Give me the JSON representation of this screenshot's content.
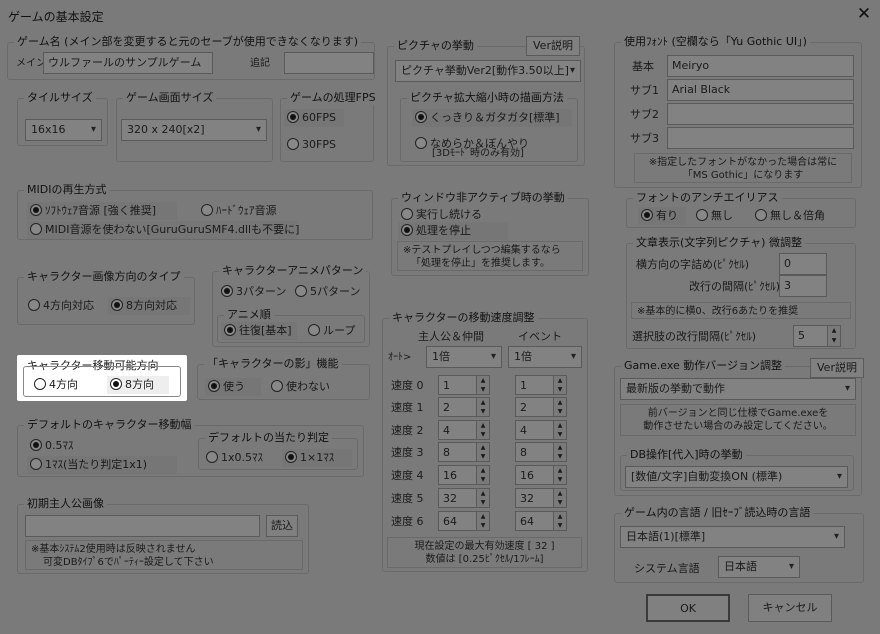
{
  "window": {
    "title": "ゲームの基本設定",
    "close": "✕"
  },
  "game_name": {
    "caption": "ゲーム名 (メイン部を変更すると元のセーブが使用できなくなります)",
    "main_label": "メイン",
    "main_value": "ウルファールのサンプルゲーム",
    "extra_label": "追記",
    "extra_value": ""
  },
  "tile_size": {
    "caption": "タイルサイズ",
    "value": "16x16"
  },
  "screen_size": {
    "caption": "ゲーム画面サイズ",
    "value": "320 x 240[x2]"
  },
  "fps": {
    "caption": "ゲームの処理FPS",
    "opt1": "60FPS",
    "opt2": "30FPS"
  },
  "midi": {
    "caption": "MIDIの再生方式",
    "opt1": "ｿﾌﾄｳｪｱ音源 [強く推奨]",
    "opt2": "ﾊｰﾄﾞｳｪｱ音源",
    "opt3": "MIDI音源を使わない[GuruGuruSMF4.dllも不要に]"
  },
  "char_dir_type": {
    "caption": "キャラクター画像方向のタイプ",
    "opt1": "4方向対応",
    "opt2": "8方向対応"
  },
  "char_anim": {
    "caption": "キャラクターアニメパターン",
    "opt1": "3パターン",
    "opt2": "5パターン",
    "order_caption": "アニメ順",
    "order1": "往復[基本]",
    "order2": "ループ"
  },
  "move_dir": {
    "caption": "キャラクター移動可能方向",
    "opt1": "4方向",
    "opt2": "8方向"
  },
  "shadow": {
    "caption": "「キャラクターの影」機能",
    "opt1": "使う",
    "opt2": "使わない"
  },
  "move_width": {
    "caption": "デフォルトのキャラクター移動幅",
    "opt1": "0.5ﾏｽ",
    "opt2": "1ﾏｽ(当たり判定1x1)",
    "hit_caption": "デフォルトの当たり判定",
    "hit1": "1x0.5ﾏｽ",
    "hit2": "1×1ﾏｽ"
  },
  "hero_image": {
    "caption": "初期主人公画像",
    "value": "",
    "load": "読込",
    "note1": "※基本ｼｽﾃﾑ2使用時は反映されません",
    "note2": "可変DBﾀｲﾌﾟ6でﾊﾟｰﾃｨｰ設定して下さい"
  },
  "picture": {
    "caption": "ピクチャの挙動",
    "help": "Ver説明",
    "value": "ピクチャ挙動Ver2[動作3.50以上]",
    "scale_caption": "ピクチャ拡大縮小時の描画方法",
    "scale1": "くっきり＆ガタガタ[標準]",
    "scale2a": "なめらか＆ぼんやり",
    "scale2b": "[3Dﾓｰﾄﾞ時のみ有効]"
  },
  "inactive": {
    "caption": "ウィンドウ非アクティブ時の挙動",
    "opt1": "実行し続ける",
    "opt2": "処理を停止",
    "note1": "※テストプレイしつつ編集するなら",
    "note2": "「処理を停止」を推奨します。"
  },
  "speed": {
    "caption": "キャラクターの移動速度調整",
    "col_hero": "主人公＆仲間",
    "col_event": "イベント",
    "auto_label": "ｵｰﾄ>",
    "auto_hero": "1倍",
    "auto_event": "1倍",
    "rows": [
      {
        "label": "速度 0",
        "hero": "1",
        "event": "1"
      },
      {
        "label": "速度 1",
        "hero": "2",
        "event": "2"
      },
      {
        "label": "速度 2",
        "hero": "4",
        "event": "4"
      },
      {
        "label": "速度 3",
        "hero": "8",
        "event": "8"
      },
      {
        "label": "速度 4",
        "hero": "16",
        "event": "16"
      },
      {
        "label": "速度 5",
        "hero": "32",
        "event": "32"
      },
      {
        "label": "速度 6",
        "hero": "64",
        "event": "64"
      }
    ],
    "note1": "現在設定の最大有効速度 [ 32 ]",
    "note2": "数値は [0.25ﾋﾟｸｾﾙ/1ﾌﾚｰﾑ]"
  },
  "font": {
    "caption": "使用ﾌｫﾝﾄ (空欄なら「Yu Gothic UI」)",
    "main_label": "基本",
    "main": "Meiryo",
    "sub1_label": "サブ1",
    "sub1": "Arial Black",
    "sub2_label": "サブ2",
    "sub2": "",
    "sub3_label": "サブ3",
    "sub3": "",
    "note1": "※指定したフォントがなかった場合は常に",
    "note2": "「MS Gothic」になります"
  },
  "aa": {
    "caption": "フォントのアンチエイリアス",
    "opt1": "有り",
    "opt2": "無し",
    "opt3": "無し＆倍角"
  },
  "text_display": {
    "caption": "文章表示(文字列ピクチャ) 微調整",
    "spacing_label": "横方向の字詰め(ﾋﾟｸｾﾙ)",
    "spacing": "0",
    "line_label": "改行の間隔(ﾋﾟｸｾﾙ)",
    "line": "3",
    "note": "※基本的に横0、改行6あたりを推奨",
    "choice_label": "選択肢の改行間隔(ﾋﾟｸｾﾙ)",
    "choice": "5"
  },
  "exe_version": {
    "caption": "Game.exe 動作バージョン調整",
    "help": "Ver説明",
    "value": "最新版の挙動で動作",
    "note1": "前バージョンと同じ仕様でGame.exeを",
    "note2": "動作させたい場合のみ設定してください。"
  },
  "db": {
    "caption": "DB操作[代入]時の挙動",
    "value": "[数値/文字]自動変換ON (標準)"
  },
  "lang": {
    "caption": "ゲーム内の言語 / 旧ｾｰﾌﾞ読込時の言語",
    "value": "日本語(1)[標準]",
    "sys_label": "システム言語",
    "sys_value": "日本語"
  },
  "footer": {
    "ok": "OK",
    "cancel": "キャンセル"
  }
}
